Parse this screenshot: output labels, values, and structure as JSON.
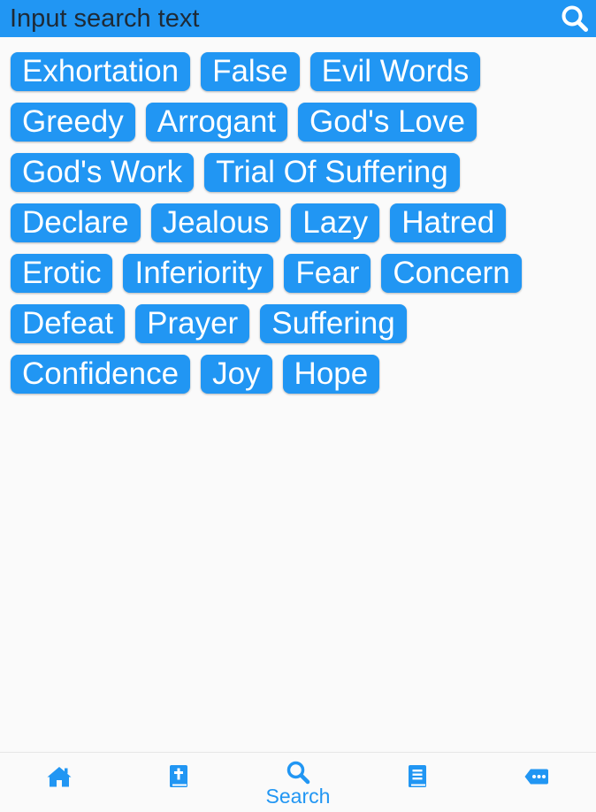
{
  "search": {
    "placeholder": "Input search text",
    "value": ""
  },
  "tags": [
    "Exhortation",
    "False",
    "Evil Words",
    "Greedy",
    "Arrogant",
    "God's Love",
    "God's Work",
    "Trial Of Suffering",
    "Declare",
    "Jealous",
    "Lazy",
    "Hatred",
    "Erotic",
    "Inferiority",
    "Fear",
    "Concern",
    "Defeat",
    "Prayer",
    "Suffering",
    "Confidence",
    "Joy",
    "Hope"
  ],
  "bottom_nav": {
    "items": [
      {
        "icon": "home-icon",
        "label": ""
      },
      {
        "icon": "bible-icon",
        "label": ""
      },
      {
        "icon": "search-icon",
        "label": "Search",
        "active": true
      },
      {
        "icon": "book-icon",
        "label": ""
      },
      {
        "icon": "more-icon",
        "label": ""
      }
    ]
  },
  "colors": {
    "accent": "#2196f3",
    "background": "#fafafa",
    "tag_text": "#ffffff",
    "search_text": "#1e2a36"
  }
}
